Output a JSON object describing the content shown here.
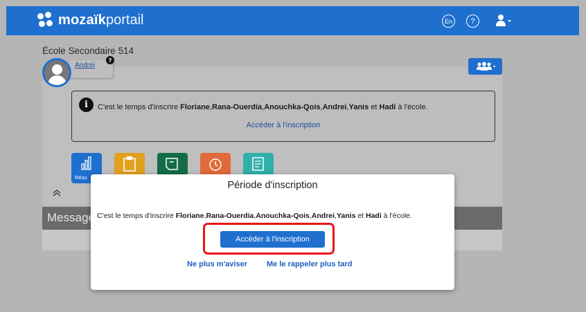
{
  "header": {
    "logo_bold": "mozaïk",
    "logo_light": "portail",
    "lang_label": "En",
    "help_label": "?",
    "brand_color": "#1f6fcf"
  },
  "page": {
    "school_name": "École Secondaire 514",
    "student_name": "Andrei",
    "question_badge": "?",
    "notice": {
      "prefix": "C'est le temps d'inscrire ",
      "names": [
        "Floriane",
        "Rana-Ouerdia",
        "Anouchka-Qois",
        "Andrei",
        "Yanis"
      ],
      "conjunction": " et ",
      "last_name": "Hadi",
      "suffix": " à l'école.",
      "link": "Accéder à l'inscription"
    },
    "tile_partial_label": "Résu",
    "messages_label": "Message"
  },
  "modal": {
    "title": "Période d'inscription",
    "prefix": "C'est le temps d'inscrire ",
    "names": [
      "Floriane",
      "Rana-Ouerdia",
      "Anouchka-Qois",
      "Andrei",
      "Yanis"
    ],
    "conjunction": " et ",
    "last_name": "Hadi",
    "suffix": " à l'école.",
    "primary_button": "Accéder à l'inscription",
    "link_dismiss": "Ne plus m'aviser",
    "link_later": "Me le rappeler plus tard",
    "highlight_color": "#e8141b"
  },
  "tiles": [
    {
      "icon": "bar-chart-icon",
      "color": "#1f6fcf"
    },
    {
      "icon": "clipboard-icon",
      "color": "#e0a020"
    },
    {
      "icon": "note-icon",
      "color": "#136b48"
    },
    {
      "icon": "clock-icon",
      "color": "#e06a3a"
    },
    {
      "icon": "checklist-icon",
      "color": "#2fb0a8"
    }
  ]
}
